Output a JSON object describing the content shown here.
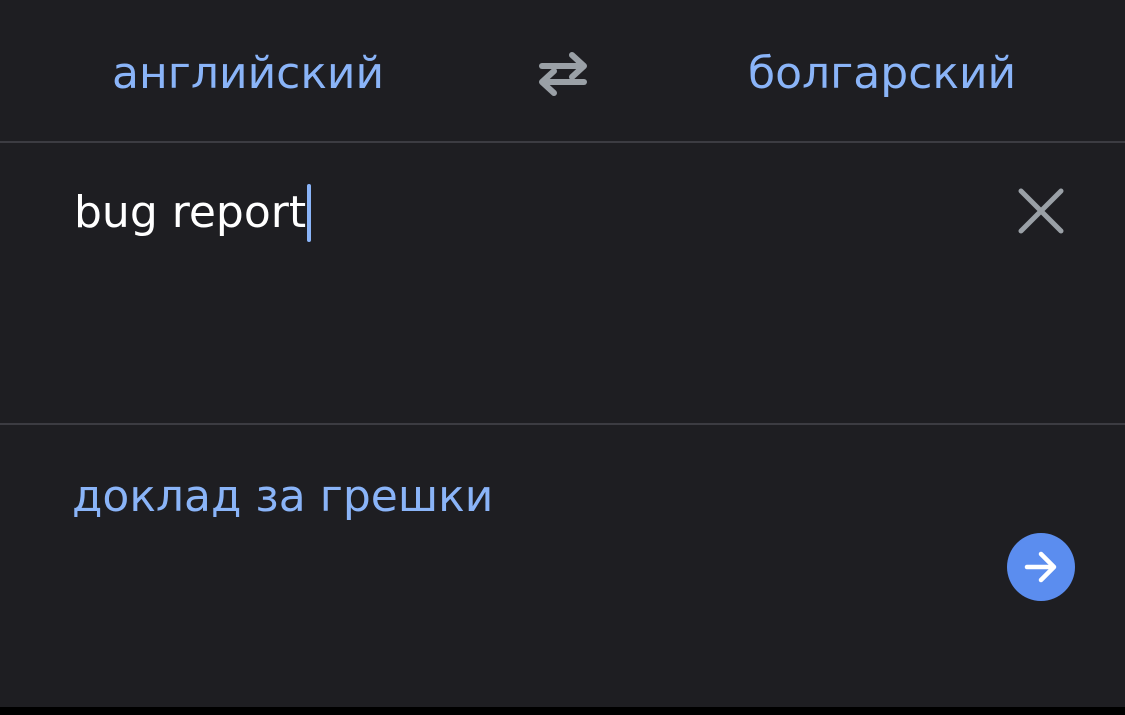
{
  "languages": {
    "source": "английский",
    "target": "болгарский"
  },
  "input": {
    "value": "bug report"
  },
  "output": {
    "translation": "доклад за грешки"
  },
  "icons": {
    "swap": "swap-arrows-icon",
    "clear": "close-icon",
    "go": "arrow-right-icon"
  },
  "colors": {
    "background": "#1e1e22",
    "accent_text": "#8ab4f8",
    "go_button": "#5b8def",
    "divider": "#3c3c42",
    "icon_gray": "#9aa0a6"
  }
}
